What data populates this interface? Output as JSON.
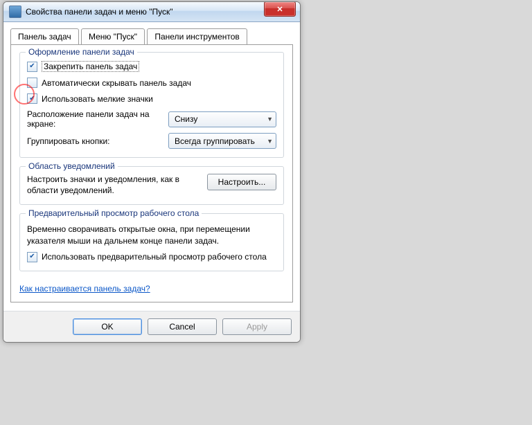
{
  "title": "Свойства панели задач и меню \"Пуск\"",
  "tabs": [
    {
      "label": "Панель задач",
      "active": true
    },
    {
      "label": "Меню \"Пуск\"",
      "active": false
    },
    {
      "label": "Панели инструментов",
      "active": false
    }
  ],
  "group_appearance": {
    "title": "Оформление панели задач",
    "chk_lock": {
      "label": "Закрепить панель задач",
      "checked": true
    },
    "chk_autohide": {
      "label": "Автоматически скрывать панель задач",
      "checked": false
    },
    "chk_small": {
      "label": "Использовать мелкие значки",
      "checked": true
    },
    "row_location": {
      "label": "Расположение панели задач на экране:",
      "value": "Снизу"
    },
    "row_group": {
      "label": "Группировать кнопки:",
      "value": "Всегда группировать"
    }
  },
  "group_notif": {
    "title": "Область уведомлений",
    "desc": "Настроить значки и уведомления, как в области уведомлений.",
    "btn": "Настроить..."
  },
  "group_preview": {
    "title": "Предварительный просмотр рабочего стола",
    "desc": "Временно сворачивать открытые окна, при перемещении указателя мыши на дальнем конце панели задач.",
    "chk": {
      "label": "Использовать предварительный просмотр рабочего стола",
      "checked": true
    }
  },
  "link": "Как настраивается панель задач?",
  "buttons": {
    "ok": "OK",
    "cancel": "Cancel",
    "apply": "Apply"
  }
}
